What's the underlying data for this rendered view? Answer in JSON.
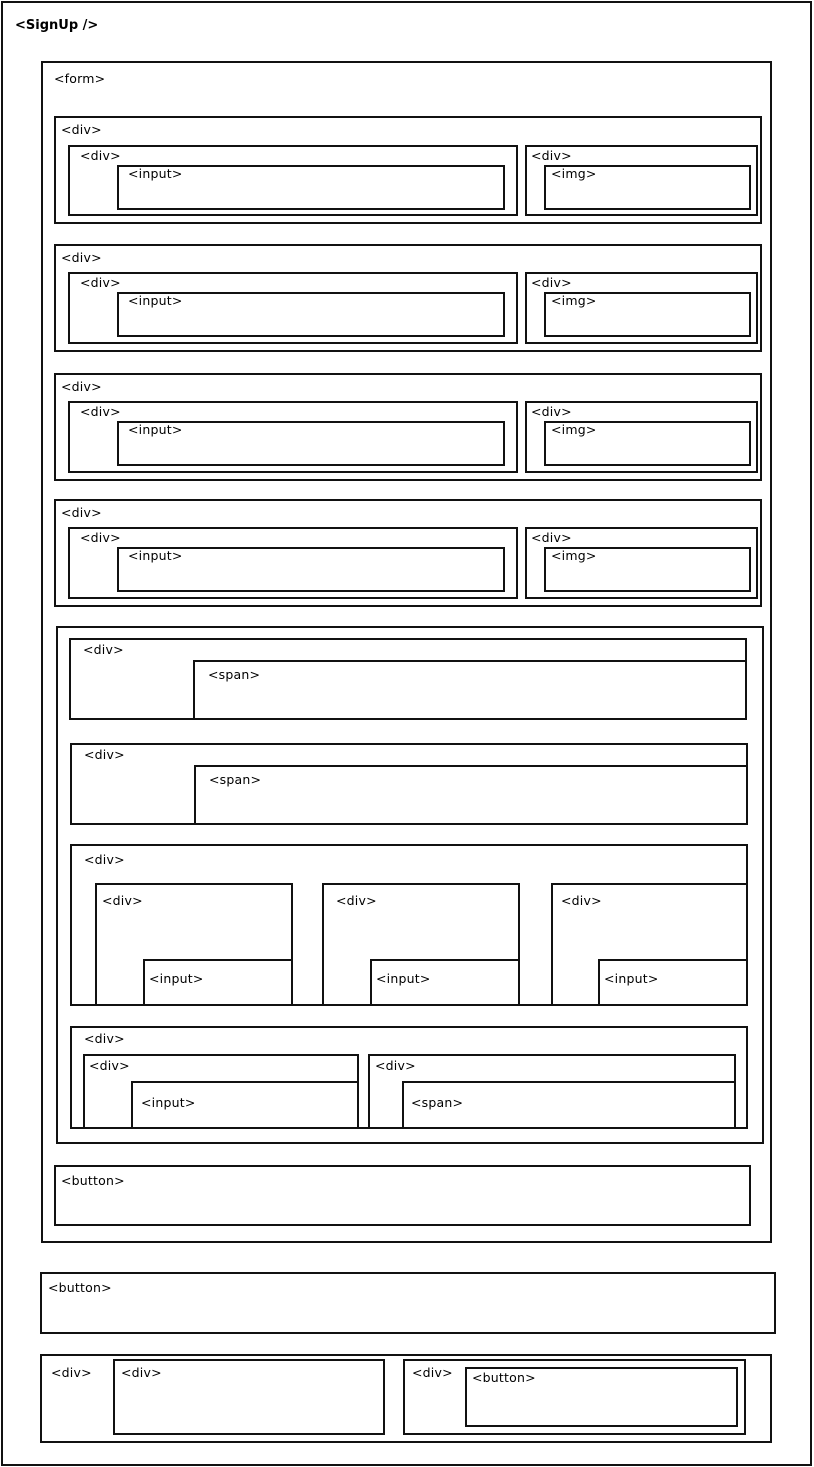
{
  "title": "<SignUp />",
  "tags": {
    "form": "<form>",
    "div": "<div>",
    "input": "<input>",
    "img": "<img>",
    "span": "<span>",
    "button": "<button>"
  }
}
